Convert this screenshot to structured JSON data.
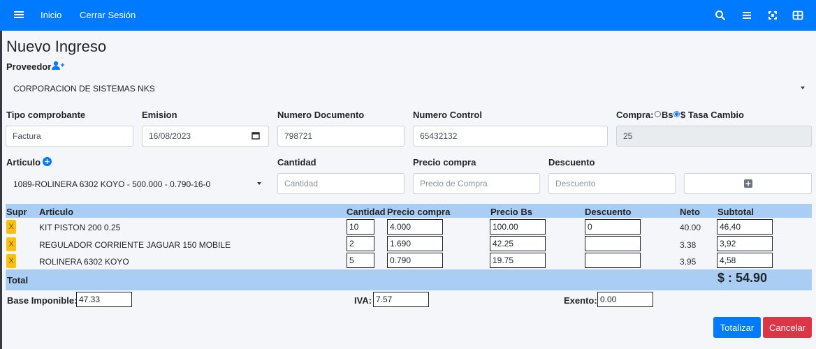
{
  "nav": {
    "home": "Inicio",
    "logout": "Cerrar Sesión"
  },
  "page_title": "Nuevo Ingreso",
  "proveedor": {
    "label": "Proveedor",
    "value": "CORPORACION DE SISTEMAS NKS"
  },
  "fields": {
    "tipo_label": "Tipo comprobante",
    "tipo_value": "Factura",
    "emision_label": "Emision",
    "emision_value": "16/08/2023",
    "numdoc_label": "Numero Documento",
    "numdoc_value": "798721",
    "numctrl_label": "Numero Control",
    "numctrl_value": "65432132",
    "compra_label": "Compra:",
    "compra_bs": "Bs",
    "compra_usd": "$",
    "tasa_label": "Tasa Cambio",
    "tasa_value": "25"
  },
  "articulo": {
    "label": "Articulo",
    "value": "1089-ROLINERA 6302 KOYO - 500.000 - 0.790-16-0",
    "cantidad_label": "Cantidad",
    "cantidad_placeholder": "Cantidad",
    "precio_label": "Precio compra",
    "precio_placeholder": "Precio de Compra",
    "descuento_label": "Descuento",
    "descuento_placeholder": "Descuento"
  },
  "table": {
    "headers": [
      "Supr",
      "Articulo",
      "Cantidad",
      "Precio compra",
      "Precio Bs",
      "Descuento",
      "Neto",
      "Subtotal"
    ],
    "rows": [
      {
        "del": "X",
        "articulo": "KIT PISTON 200 0.25",
        "cantidad": "10",
        "precio": "4.000",
        "precio_bs": "100.00",
        "descuento": "0",
        "neto": "40.00",
        "subtotal": "46,40"
      },
      {
        "del": "X",
        "articulo": "REGULADOR CORRIENTE JAGUAR 150 MOBILE",
        "cantidad": "2",
        "precio": "1.690",
        "precio_bs": "42.25",
        "descuento": "",
        "neto": "3.38",
        "subtotal": "3,92"
      },
      {
        "del": "X",
        "articulo": "ROLINERA 6302 KOYO",
        "cantidad": "5",
        "precio": "0.790",
        "precio_bs": "19.75",
        "descuento": "",
        "neto": "3.95",
        "subtotal": "4,58"
      }
    ],
    "total_label": "Total",
    "total_value": "$ : 54.90"
  },
  "summary": {
    "base_label": "Base Imponible:",
    "base_value": "47.33",
    "iva_label": "IVA:",
    "iva_value": "7.57",
    "exento_label": "Exento:",
    "exento_value": "0.00"
  },
  "buttons": {
    "totalizar": "Totalizar",
    "cancelar": "Cancelar"
  },
  "colors": {
    "primary": "#007bff",
    "danger": "#dc3545",
    "warning": "#ffc107",
    "table_header": "#a9cdf3"
  }
}
